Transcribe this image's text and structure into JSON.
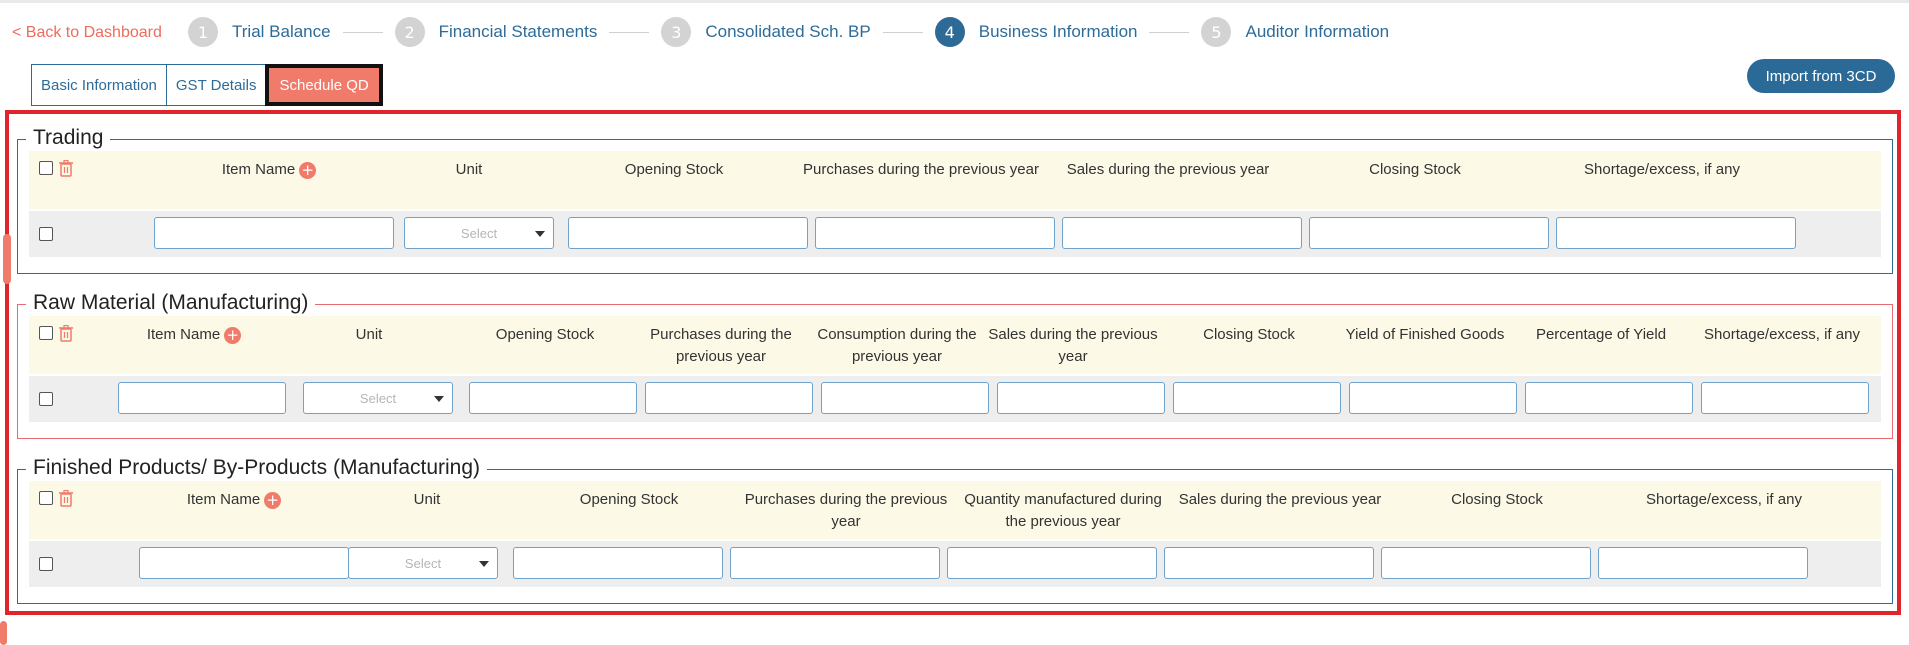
{
  "nav": {
    "back_label": "< Back to Dashboard"
  },
  "steps": [
    {
      "num": "1",
      "label": "Trial Balance"
    },
    {
      "num": "2",
      "label": "Financial Statements"
    },
    {
      "num": "3",
      "label": "Consolidated Sch. BP"
    },
    {
      "num": "4",
      "label": "Business Information",
      "active": true
    },
    {
      "num": "5",
      "label": "Auditor Information"
    }
  ],
  "tabs": [
    "Basic Information",
    "GST Details",
    "Schedule QD"
  ],
  "active_tab": "Schedule QD",
  "import_label": "Import from 3CD",
  "colors": {
    "accent": "#f07b6b",
    "primary": "#2d6b99",
    "frame": "#e0242b"
  },
  "trading": {
    "title": "Trading",
    "headers": [
      "Item Name",
      "Unit",
      "Opening Stock",
      "Purchases during the previous year",
      "Sales during the previous year",
      "Closing Stock",
      "Shortage/excess, if any"
    ],
    "unit_placeholder": "Select"
  },
  "raw": {
    "title": "Raw Material (Manufacturing)",
    "headers": [
      "Item Name",
      "Unit",
      "Opening Stock",
      "Purchases during the previous year",
      "Consumption during the previous year",
      "Sales during the previous year",
      "Closing Stock",
      "Yield of Finished Goods",
      "Percentage of Yield",
      "Shortage/excess, if any"
    ],
    "unit_placeholder": "Select"
  },
  "finished": {
    "title": "Finished Products/ By-Products (Manufacturing)",
    "headers": [
      "Item Name",
      "Unit",
      "Opening Stock",
      "Purchases during the previous year",
      "Quantity manufactured during the previous year",
      "Sales during the previous year",
      "Closing Stock",
      "Shortage/excess, if any"
    ],
    "unit_placeholder": "Select"
  }
}
